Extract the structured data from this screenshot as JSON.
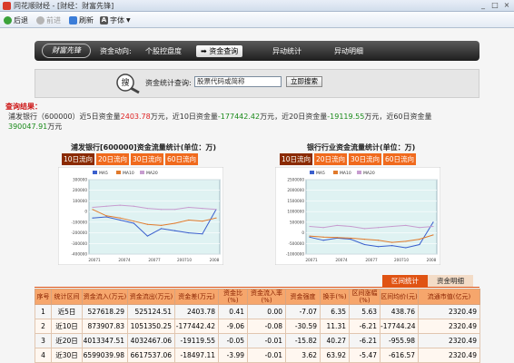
{
  "window": {
    "title": "同花顺财经 - [财经：财富先锋]",
    "controls": [
      "_",
      "□",
      "×"
    ]
  },
  "toolbar": {
    "items": [
      {
        "label": "后退",
        "icon": "back-icon"
      },
      {
        "label": "前进",
        "icon": "forward-icon"
      },
      {
        "label": "刷新",
        "icon": "refresh-icon"
      },
      {
        "label": "字体",
        "icon": "font-icon"
      }
    ],
    "dropdown_arrow": "▼"
  },
  "nav": {
    "logo": "财富先锋",
    "items": [
      {
        "label": "资金动向:"
      },
      {
        "label": "个股控盘度"
      },
      {
        "label": "资金查询",
        "prefix": "➡"
      },
      {
        "label": "异动统计"
      },
      {
        "label": "异动明细"
      }
    ]
  },
  "query": {
    "icon_text": "搜",
    "label": "资金统计查询:",
    "input_value": "股票代码或简称",
    "button": "立即搜索"
  },
  "result": {
    "title": "查询结果：",
    "line1_prefix": "浦发银行（600000）近5日资金量",
    "v5": "2403.78",
    "sep1": "万元，近10日资金量",
    "v10": "-177442.42",
    "sep2": "万元，近20日资金量",
    "v20": "-19119.55",
    "sep3": "万元，近60日资金量",
    "v60": "390047.91",
    "suffix": "万元"
  },
  "charts": [
    {
      "title": "浦发银行[600000]资金流量统计(单位：万)",
      "tabs": [
        "10日流向",
        "20日流向",
        "30日流向",
        "60日流向"
      ],
      "legend": [
        "MA5",
        "MA10",
        "MA20"
      ],
      "y_ticks": [
        "300000",
        "200000",
        "100000",
        "0",
        "-100000",
        "-200000",
        "-300000",
        "-400000"
      ],
      "x_ticks": [
        "20071",
        "20074",
        "20077",
        "200710",
        "2008"
      ]
    },
    {
      "title": "银行行业资金流量统计(单位：万)",
      "tabs": [
        "10日流向",
        "20日流向",
        "30日流向",
        "60日流向"
      ],
      "legend": [
        "MA5",
        "MA10",
        "MA20"
      ],
      "y_ticks": [
        "2500000",
        "2000000",
        "1500000",
        "1000000",
        "500000",
        "0",
        "-500000",
        "-1000000"
      ],
      "x_ticks": [
        "20071",
        "20074",
        "20077",
        "200710",
        "2008"
      ]
    }
  ],
  "chart_data": [
    {
      "type": "line",
      "title": "浦发银行[600000]资金流量统计(单位：万)",
      "x": [
        1,
        2,
        3,
        4,
        5,
        6,
        7,
        8,
        9,
        10
      ],
      "series": [
        {
          "name": "MA5",
          "color": "#3a5fcd",
          "values": [
            -60000,
            -50000,
            -80000,
            -110000,
            -230000,
            -160000,
            -180000,
            -200000,
            -210000,
            20000
          ]
        },
        {
          "name": "MA10",
          "color": "#e07a2c",
          "values": [
            20000,
            -40000,
            -60000,
            -90000,
            -120000,
            -130000,
            -110000,
            -80000,
            -90000,
            -60000
          ]
        },
        {
          "name": "MA20",
          "color": "#c79ccf",
          "values": [
            40000,
            50000,
            60000,
            50000,
            30000,
            20000,
            20000,
            40000,
            30000,
            20000
          ]
        }
      ],
      "ylim": [
        -400000,
        300000
      ]
    },
    {
      "type": "line",
      "title": "银行行业资金流量统计(单位：万)",
      "x": [
        1,
        2,
        3,
        4,
        5,
        6,
        7,
        8,
        9,
        10
      ],
      "series": [
        {
          "name": "MA5",
          "color": "#3a5fcd",
          "values": [
            -200000,
            -350000,
            -250000,
            -300000,
            -550000,
            -650000,
            -600000,
            -700000,
            -550000,
            500000
          ]
        },
        {
          "name": "MA10",
          "color": "#e07a2c",
          "values": [
            -150000,
            -200000,
            -220000,
            -250000,
            -300000,
            -350000,
            -450000,
            -400000,
            -300000,
            -100000
          ]
        },
        {
          "name": "MA20",
          "color": "#c79ccf",
          "values": [
            300000,
            250000,
            350000,
            300000,
            200000,
            250000,
            300000,
            350000,
            250000,
            300000
          ]
        }
      ],
      "ylim": [
        -1000000,
        2500000
      ]
    }
  ],
  "stats_tabs": [
    "区间统计",
    "资金明细"
  ],
  "table": {
    "headers": [
      "序号",
      "统计区间",
      "资金流入(万元)",
      "资金流出(万元)",
      "资金差(万元)",
      "资金比(%)",
      "资金流入率(%)",
      "资金强度",
      "换手(%)",
      "区间涨幅(%)",
      "区间均价(元)",
      "流通市值(亿元)"
    ],
    "rows": [
      [
        "1",
        "近5日",
        "527618.29",
        "525124.51",
        "2403.78",
        "0.41",
        "0.00",
        "-7.07",
        "6.35",
        "5.63",
        "438.76",
        "2320.49"
      ],
      [
        "2",
        "近10日",
        "873907.83",
        "1051350.25",
        "-177442.42",
        "-9.06",
        "-0.08",
        "-30.59",
        "11.31",
        "-6.21",
        "-17744.24",
        "2320.49"
      ],
      [
        "3",
        "近20日",
        "4013347.51",
        "4032467.06",
        "-19119.55",
        "-0.05",
        "-0.01",
        "-15.82",
        "40.27",
        "-6.21",
        "-955.98",
        "2320.49"
      ],
      [
        "4",
        "近30日",
        "6599039.98",
        "6617537.06",
        "-18497.11",
        "-3.99",
        "-0.01",
        "3.62",
        "63.92",
        "-5.47",
        "-616.57",
        "2320.49"
      ]
    ]
  }
}
